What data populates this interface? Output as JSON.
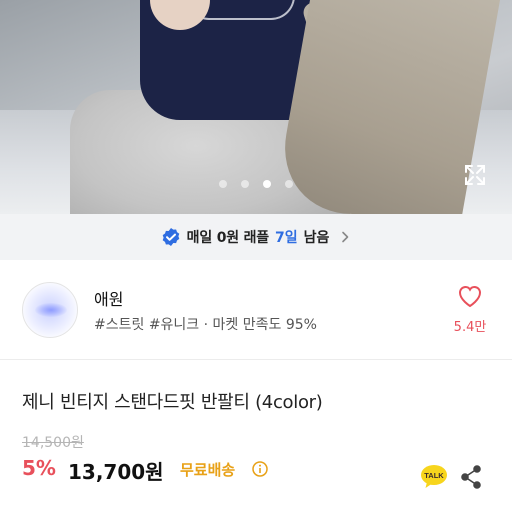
{
  "gallery": {
    "dot_count": 4,
    "active_index": 2,
    "expand_icon": "expand-icon"
  },
  "raffle": {
    "text": "매일 0원 래플",
    "days": "7일",
    "remain": "남음",
    "check_icon": "verified-check-icon",
    "accent": "#2f6de1"
  },
  "shop": {
    "name": "애원",
    "tags": "#스트릿 #유니크 · 마켓 만족도 95%",
    "like_count": "5.4만",
    "like_color": "#e8505b"
  },
  "product": {
    "title": "제니 빈티지 스탠다드핏 반팔티 (4color)",
    "original_price": "14,500원",
    "discount": "5%",
    "price": "13,700원",
    "shipping": "무료배송",
    "shipping_color": "#e8a117",
    "talk_label": "TALK"
  }
}
